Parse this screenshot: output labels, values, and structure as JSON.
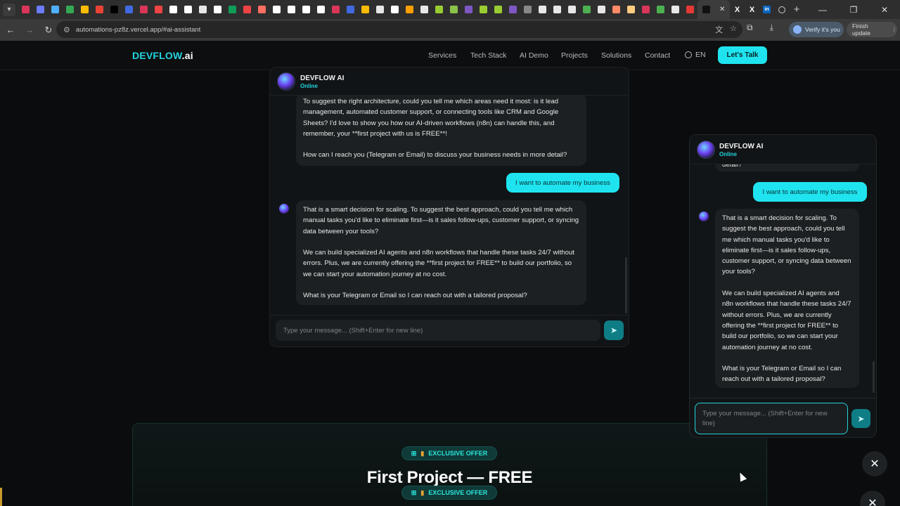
{
  "browser": {
    "url": "automations-pz8z.vercel.app/#ai-assistant",
    "verify_label": "Verify it's you",
    "finish_label": "Finish update",
    "tab_favicon_colors": [
      "#d9365a",
      "#6b7cff",
      "#4fb0ff",
      "#35a853",
      "#fbbc05",
      "#ea4335",
      "#000000",
      "#4169e1",
      "#d9365a",
      "#e44",
      "#ffffff",
      "#ffffff",
      "#e7e7e7",
      "#ffffff",
      "#0f9d58",
      "#e44",
      "#ff6f61",
      "#ffffff",
      "#ffffff",
      "#ffffff",
      "#ffffff",
      "#d9365a",
      "#4169e1",
      "#fbbc05",
      "#e7e7e7",
      "#ffffff",
      "#ffa000",
      "#e7e7e7",
      "#9acd32",
      "#8bc34a",
      "#7e57c2",
      "#9acd32",
      "#9acd32",
      "#7e57c2",
      "#888888",
      "#e7e7e7",
      "#e7e7e7",
      "#e7e7e7",
      "#4caf50",
      "#e7e7e7",
      "#ff8a65",
      "#ffcc80",
      "#d9365a",
      "#4caf50",
      "#e7e7e7",
      "#e53935",
      "#111111"
    ],
    "tab_icons": [
      "x-logo",
      "x-logo",
      "linkedin-logo",
      "globe"
    ]
  },
  "nav": {
    "logo_main": "DEVFLOW",
    "logo_suffix": ".ai",
    "links": [
      "Services",
      "Tech Stack",
      "AI Demo",
      "Projects",
      "Solutions",
      "Contact"
    ],
    "lang": "EN",
    "cta": "Let's Talk"
  },
  "main_chat": {
    "bot_name": "DEVFLOW AI",
    "status": "Online",
    "msg1_p1": "To suggest the right architecture, could you tell me which areas need it most: is it lead management, automated customer support, or connecting tools like CRM and Google Sheets? I'd love to show you how our AI-driven workflows (n8n) can handle this, and remember, your **first project with us is FREE**!",
    "msg1_p2": "How can I reach you (Telegram or Email) to discuss your business needs in more detail?",
    "user_msg": "I want to automate my business",
    "msg2_p1": "That is a smart decision for scaling. To suggest the best approach, could you tell me which manual tasks you'd like to eliminate first—is it sales follow-ups, customer support, or syncing data between your tools?",
    "msg2_p2": "We can build specialized AI agents and n8n workflows that handle these tasks 24/7 without errors. Plus, we are currently offering the **first project for FREE** to build our portfolio, so we can start your automation journey at no cost.",
    "msg2_p3": "What is your Telegram or Email so I can reach out with a tailored proposal?",
    "input_placeholder": "Type your message... (Shift+Enter for new line)"
  },
  "widget": {
    "bot_name": "DEVFLOW AI",
    "status": "Online",
    "prev_tail": "detail?",
    "user_msg": "I want to automate my business",
    "bot_p1": "That is a smart decision for scaling. To suggest the best approach, could you tell me which manual tasks you'd like to eliminate first—is it sales follow-ups, customer support, or syncing data between your tools?",
    "bot_p2": "We can build specialized AI agents and n8n workflows that handle these tasks 24/7 without errors. Plus, we are currently offering the **first project for FREE** to build our portfolio, so we can start your automation journey at no cost.",
    "bot_p3": "What is your Telegram or Email so I can reach out with a tailored proposal?",
    "input_placeholder": "Type your message... (Shift+Enter for new line)"
  },
  "offer": {
    "badge": "EXCLUSIVE OFFER",
    "title": "First Project — FREE"
  },
  "colors": {
    "accent": "#1fe4ef",
    "bg": "#0a0c0d",
    "bubble": "#1c2022"
  }
}
